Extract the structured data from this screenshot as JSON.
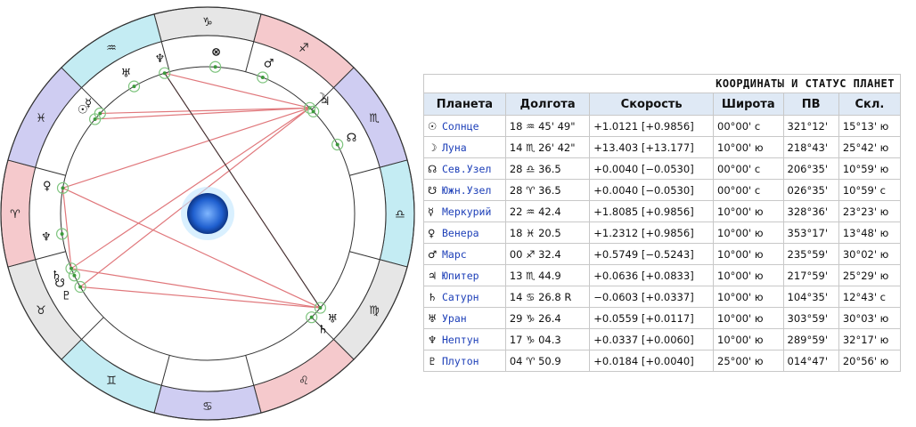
{
  "table": {
    "caption": "КООРДИНАТЫ И СТАТУС ПЛАНЕТ",
    "headers": [
      "Планета",
      "Долгота",
      "Скорость",
      "Широта",
      "ПВ",
      "Скл."
    ],
    "rows": [
      {
        "glyph": "☉",
        "name": "Солнце",
        "lon": "18 ♒ 45' 49\"",
        "speed": "+1.0121  [+0.9856]",
        "lat": "00°00' с",
        "ra": "321°12'",
        "dec": "15°13' ю"
      },
      {
        "glyph": "☽",
        "name": "Луна",
        "lon": "14 ♏ 26' 42\"",
        "speed": "+13.403  [+13.177]",
        "lat": "10°00' ю",
        "ra": "218°43'",
        "dec": "25°42' ю"
      },
      {
        "glyph": "☊",
        "name": "Сев.Узел",
        "lon": "28 ♎ 36.5",
        "speed": "+0.0040  [−0.0530]",
        "lat": "00°00' с",
        "ra": "206°35'",
        "dec": "10°59' ю"
      },
      {
        "glyph": "☋",
        "name": "Южн.Узел",
        "lon": "28 ♈ 36.5",
        "speed": "+0.0040  [−0.0530]",
        "lat": "00°00' с",
        "ra": "026°35'",
        "dec": "10°59' с"
      },
      {
        "glyph": "☿",
        "name": "Меркурий",
        "lon": "22 ♒ 42.4",
        "speed": "+1.8085  [+0.9856]",
        "lat": "10°00' ю",
        "ra": "328°36'",
        "dec": "23°23' ю"
      },
      {
        "glyph": "♀",
        "name": "Венера",
        "lon": "18 ♓ 20.5",
        "speed": "+1.2312  [+0.9856]",
        "lat": "10°00' ю",
        "ra": "353°17'",
        "dec": "13°48' ю"
      },
      {
        "glyph": "♂",
        "name": "Марс",
        "lon": "00 ♐ 32.4",
        "speed": "+0.5749  [−0.5243]",
        "lat": "10°00' ю",
        "ra": "235°59'",
        "dec": "30°02' ю"
      },
      {
        "glyph": "♃",
        "name": "Юпитер",
        "lon": "13 ♏ 44.9",
        "speed": "+0.0636  [+0.0833]",
        "lat": "10°00' ю",
        "ra": "217°59'",
        "dec": "25°29' ю"
      },
      {
        "glyph": "♄",
        "name": "Сатурн",
        "lon": "14 ♋ 26.8  R",
        "speed": "−0.0603  [+0.0337]",
        "lat": "10°00' ю",
        "ra": "104°35'",
        "dec": "12°43' с"
      },
      {
        "glyph": "♅",
        "name": "Уран",
        "lon": "29 ♑ 26.4",
        "speed": "+0.0559  [+0.0117]",
        "lat": "10°00' ю",
        "ra": "303°59'",
        "dec": "30°03' ю"
      },
      {
        "glyph": "♆",
        "name": "Нептун",
        "lon": "17 ♑ 04.3",
        "speed": "+0.0337  [+0.0060]",
        "lat": "10°00' ю",
        "ra": "289°59'",
        "dec": "32°17' ю"
      },
      {
        "glyph": "♇",
        "name": "Плутон",
        "lon": "04 ♈ 50.9",
        "speed": "+0.0184  [+0.0040]",
        "lat": "25°00' ю",
        "ra": "014°47'",
        "dec": "20°56' ю"
      }
    ]
  },
  "wheel": {
    "signs": [
      {
        "glyph": "♑",
        "color": "#e6e6e6"
      },
      {
        "glyph": "♐",
        "color": "#f5c9cc"
      },
      {
        "glyph": "♏",
        "color": "#cfcdf2"
      },
      {
        "glyph": "♎",
        "color": "#c4ecf3"
      },
      {
        "glyph": "♍",
        "color": "#e6e6e6"
      },
      {
        "glyph": "♌",
        "color": "#f5c9cc"
      },
      {
        "glyph": "♋",
        "color": "#cfcdf2"
      },
      {
        "glyph": "♊",
        "color": "#c4ecf3"
      },
      {
        "glyph": "♉",
        "color": "#e6e6e6"
      },
      {
        "glyph": "♈",
        "color": "#f5c9cc"
      },
      {
        "glyph": "♓",
        "color": "#cfcdf2"
      },
      {
        "glyph": "♒",
        "color": "#c4ecf3"
      }
    ],
    "planets": [
      {
        "glyph": "♅"
      },
      {
        "glyph": "♆"
      },
      {
        "glyph": "⊗"
      },
      {
        "glyph": "♂"
      },
      {
        "glyph": "☽"
      },
      {
        "glyph": "♃"
      },
      {
        "glyph": "☊"
      },
      {
        "glyph": "☉"
      },
      {
        "glyph": "☿"
      },
      {
        "glyph": "♀"
      },
      {
        "glyph": "♆"
      },
      {
        "glyph": "♄"
      },
      {
        "glyph": "♇"
      },
      {
        "glyph": "♅"
      },
      {
        "glyph": "♄"
      },
      {
        "glyph": "☋"
      }
    ]
  }
}
